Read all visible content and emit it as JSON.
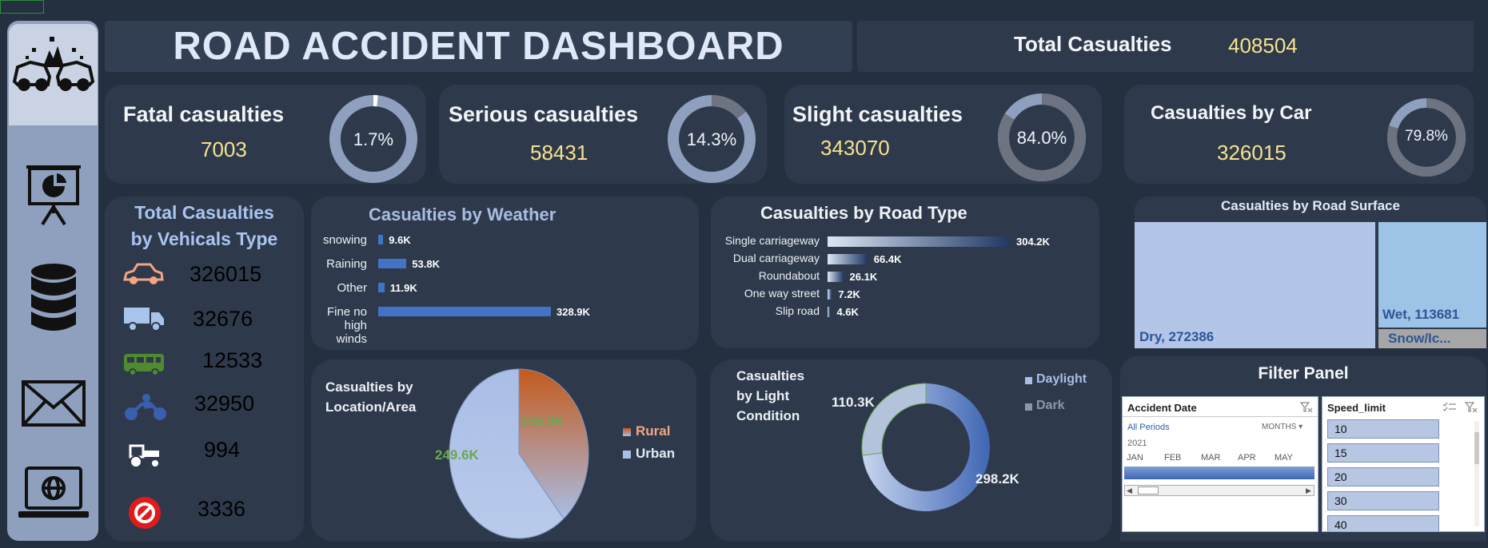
{
  "header": {
    "title": "ROAD ACCIDENT DASHBOARD",
    "total_label": "Total Casualties",
    "total_value": "408504"
  },
  "sidebar": {
    "items": [
      {
        "name": "car-crash-icon",
        "active": true
      },
      {
        "name": "presentation-chart-icon",
        "active": false
      },
      {
        "name": "database-icon",
        "active": false
      },
      {
        "name": "mail-icon",
        "active": false
      },
      {
        "name": "laptop-globe-icon",
        "active": false
      }
    ]
  },
  "kpis": {
    "fatal": {
      "label": "Fatal casualties",
      "value": "7003",
      "pct_label": "1.7%",
      "pct": 0.017
    },
    "serious": {
      "label": "Serious casualties",
      "value": "58431",
      "pct_label": "14.3%",
      "pct": 0.143
    },
    "slight": {
      "label": "Slight casualties",
      "value": "343070",
      "pct_label": "84.0%",
      "pct": 0.84
    },
    "car": {
      "label": "Casualties by Car",
      "value": "326015",
      "pct_label": "79.8%",
      "pct": 0.798
    }
  },
  "vehicles": {
    "title_line1": "Total Casualties",
    "title_line2": "by Vehicals Type",
    "items": [
      {
        "icon": "car-icon",
        "value": "326015",
        "color": "#f4a582"
      },
      {
        "icon": "truck-icon",
        "value": "32676",
        "color": "#a8c4ea"
      },
      {
        "icon": "bus-icon",
        "value": "12533",
        "color": "#4f8a2e"
      },
      {
        "icon": "motorcycle-icon",
        "value": "32950",
        "color": "#3a5fb0"
      },
      {
        "icon": "tractor-icon",
        "value": "994",
        "color": "#d9dde3"
      },
      {
        "icon": "no-entry-icon",
        "value": "3336",
        "color": "#e01b1b"
      }
    ]
  },
  "chart_data": [
    {
      "type": "bar",
      "title": "Casualties by Weather",
      "categories": [
        "snowing",
        "Raining",
        "Other",
        "Fine no high winds"
      ],
      "values": [
        9.6,
        53.8,
        11.9,
        328.9
      ],
      "labels": [
        "9.6K",
        "53.8K",
        "11.9K",
        "328.9K"
      ]
    },
    {
      "type": "bar",
      "title": "Casualties by Road Type",
      "categories": [
        "Single carriageway",
        "Dual carriageway",
        "Roundabout",
        "One way street",
        "Slip road"
      ],
      "values": [
        304.2,
        66.4,
        26.1,
        7.2,
        4.6
      ],
      "labels": [
        "304.2K",
        "66.4K",
        "26.1K",
        "7.2K",
        "4.6K"
      ]
    },
    {
      "type": "heatmap",
      "title": "Casualties by Road Surface",
      "categories": [
        "Dry",
        "Wet",
        "Snow/Ic..."
      ],
      "values": [
        272386,
        113681,
        null
      ],
      "labels": [
        "Dry, 272386",
        "Wet, 113681",
        "Snow/Ic..."
      ]
    },
    {
      "type": "pie",
      "title": "Casualties by Location/Area",
      "series": [
        {
          "name": "Rural",
          "value": 158.9,
          "label": "158.9K",
          "color": "#c45a1c"
        },
        {
          "name": "Urban",
          "value": 249.6,
          "label": "249.6K",
          "color": "#a9bde6"
        }
      ]
    },
    {
      "type": "pie",
      "title": "Casualties by Light Condition",
      "series": [
        {
          "name": "Daylight",
          "value": 298.2,
          "label": "298.2K",
          "color": "#3f66b4"
        },
        {
          "name": "Dark",
          "value": 110.3,
          "label": "110.3K",
          "color": "#8d97a6"
        }
      ]
    }
  ],
  "titles": {
    "weather": "Casualties by Weather",
    "road_type": "Casualties by Road Type",
    "surface": "Casualties by Road Surface",
    "location_line1": "Casualties by",
    "location_line2": "Location/Area",
    "light_line1": "Casualties",
    "light_line2": "by Light",
    "light_line3": "Condition"
  },
  "filter_panel": {
    "title": "Filter Panel",
    "date": {
      "label": "Accident Date",
      "period": "All Periods",
      "granularity": "MONTHS",
      "year": "2021",
      "months": [
        "JAN",
        "FEB",
        "MAR",
        "APR",
        "MAY"
      ]
    },
    "speed": {
      "label": "Speed_limit",
      "options": [
        "10",
        "15",
        "20",
        "30",
        "40"
      ]
    }
  },
  "colors": {
    "background": "#243040",
    "panel": "#2e3a4c",
    "accent": "#3f66b4",
    "kpi_value": "#f6e28d"
  }
}
